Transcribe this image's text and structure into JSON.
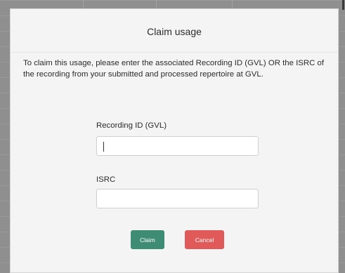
{
  "dialog": {
    "title": "Claim usage",
    "description": "To claim this usage, please enter the associated Recording ID (GVL) OR the ISRC of the recording from your submitted and processed repertoire at GVL.",
    "fields": {
      "recording_id": {
        "label": "Recording ID (GVL)",
        "value": "",
        "placeholder": ""
      },
      "isrc": {
        "label": "ISRC",
        "value": "",
        "placeholder": ""
      }
    },
    "buttons": {
      "claim_label": "Claim",
      "cancel_label": "Cancel"
    }
  },
  "colors": {
    "claim_button": "#3e8c73",
    "cancel_button": "#e05a5a",
    "overlay": "#8f8f8f",
    "dialog_background": "#f4f4f4"
  }
}
